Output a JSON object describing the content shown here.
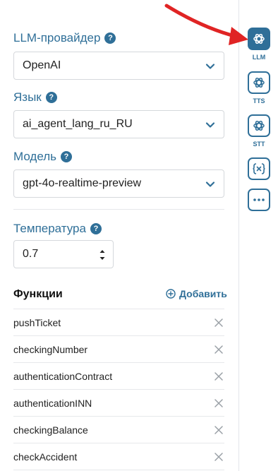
{
  "llm_provider": {
    "label": "LLM-провайдер",
    "help": "?",
    "value": "OpenAI"
  },
  "language": {
    "label": "Язык",
    "help": "?",
    "value": "ai_agent_lang_ru_RU"
  },
  "model": {
    "label": "Модель",
    "help": "?",
    "value": "gpt-4o-realtime-preview"
  },
  "temperature": {
    "label": "Температура",
    "help": "?",
    "value": "0.7"
  },
  "functions": {
    "title": "Функции",
    "add_label": "Добавить",
    "items": [
      "pushTicket",
      "checkingNumber",
      "authenticationContract",
      "authenticationINN",
      "checkingBalance",
      "checkAccident"
    ]
  },
  "rail": {
    "items": [
      {
        "caption": "LLM",
        "icon": "openai-icon",
        "active": true
      },
      {
        "caption": "TTS",
        "icon": "openai-icon",
        "active": false
      },
      {
        "caption": "STT",
        "icon": "openai-icon",
        "active": false
      },
      {
        "caption": "",
        "icon": "variable-icon",
        "active": false
      },
      {
        "caption": "",
        "icon": "more-icon",
        "active": false
      }
    ]
  },
  "colors": {
    "accent": "#2f6f98",
    "arrow": "#e02424",
    "border": "#d5d8dc"
  }
}
